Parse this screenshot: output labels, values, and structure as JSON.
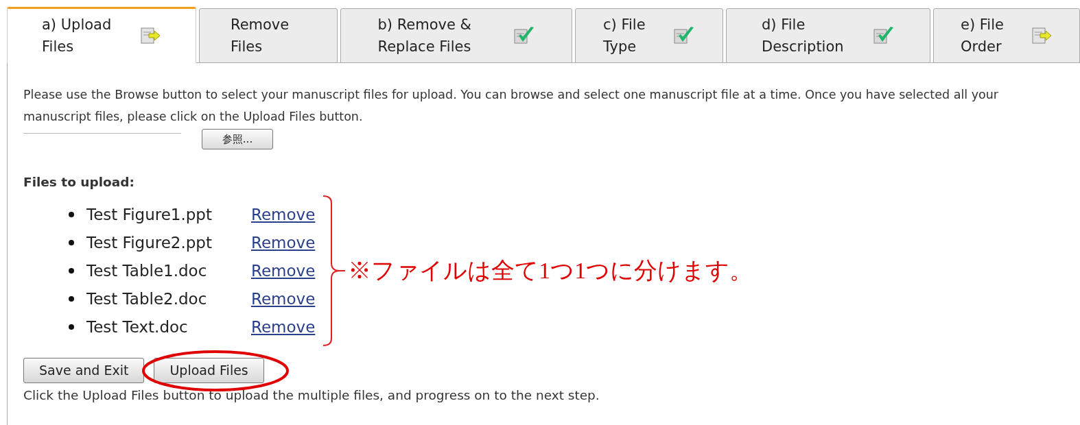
{
  "tabs": [
    {
      "label": "a) Upload Files",
      "selected": true,
      "kind": "arrow"
    },
    {
      "label": "Remove Files",
      "selected": false
    },
    {
      "label": "b) Remove & Replace Files",
      "selected": false,
      "kind": "check"
    },
    {
      "label": "c) File Type",
      "selected": false,
      "kind": "check"
    },
    {
      "label": "d) File Description",
      "selected": false,
      "kind": "check"
    },
    {
      "label": "e) File Order",
      "selected": false,
      "kind": "arrow"
    }
  ],
  "instructions": "Please use the Browse button to select your manuscript files for upload. You can browse and select one manuscript file at a time. Once you have selected all your manuscript files, please click on the Upload Files button.",
  "browse_button": "参照...",
  "files_heading": "Files to upload:",
  "files": [
    {
      "name": "Test Figure1.ppt",
      "action": "Remove"
    },
    {
      "name": "Test Figure2.ppt",
      "action": "Remove"
    },
    {
      "name": "Test Table1.doc",
      "action": "Remove"
    },
    {
      "name": "Test Table2.doc",
      "action": "Remove"
    },
    {
      "name": "Test Text.doc",
      "action": "Remove"
    }
  ],
  "annotation": "※ファイルは全て1つ1つに分けます。",
  "buttons": [
    {
      "label": "Save and Exit",
      "highlighted": false
    },
    {
      "label": "Upload Files",
      "highlighted": true
    }
  ],
  "footer": "Click the Upload Files button to upload the multiple files, and progress on to the next step."
}
